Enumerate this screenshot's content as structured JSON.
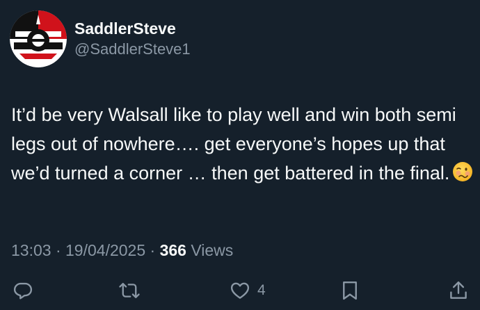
{
  "user": {
    "display_name": "SaddlerSteve",
    "handle": "@SaddlerSteve1",
    "avatar_icon": "saddler-logo-icon"
  },
  "tweet": {
    "text": "It’d be very Walsall like to play well and win both semi legs out of nowhere…. get everyone’s hopes up that we’d turned a corner … then get battered in the final.",
    "emoji": "woozy-face-icon"
  },
  "meta": {
    "time": "13:03",
    "date": "19/04/2025",
    "separator": "·",
    "views_count": "366",
    "views_label": "Views"
  },
  "actions": {
    "reply_icon": "reply-icon",
    "retweet_icon": "retweet-icon",
    "like_icon": "heart-icon",
    "like_count": "4",
    "bookmark_icon": "bookmark-icon",
    "share_icon": "share-icon"
  },
  "colors": {
    "background": "#15202b",
    "text_primary": "#f7f9f9",
    "text_secondary": "#8b98a5",
    "avatar_red": "#d0121b"
  }
}
